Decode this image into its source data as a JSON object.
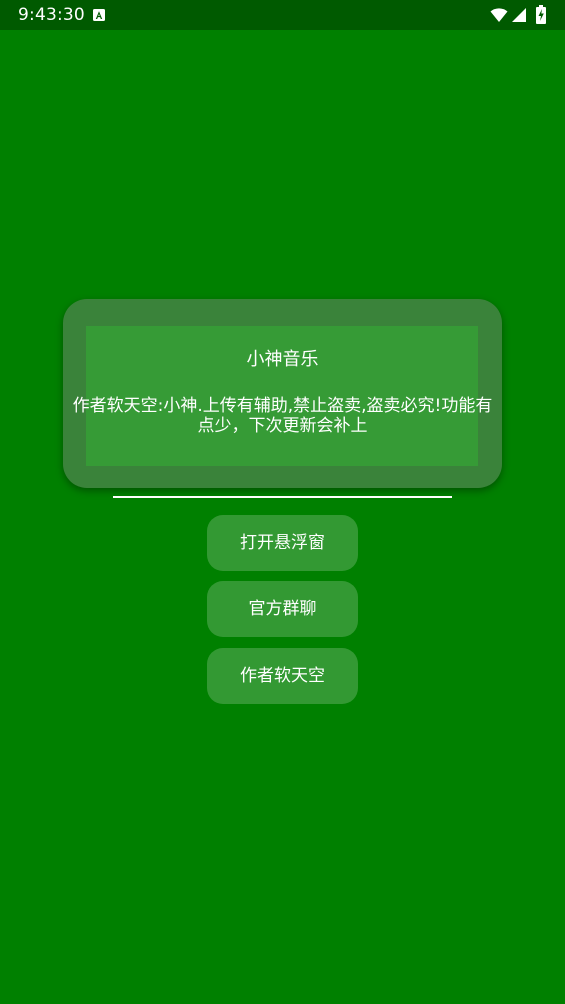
{
  "status_bar": {
    "time": "9:43:30",
    "notification_icon": "font-a-notification-icon",
    "wifi_icon": "wifi-icon",
    "signal_icon": "cell-signal-icon",
    "battery_icon": "battery-charging-icon"
  },
  "dialog": {
    "title": "小神音乐",
    "message": "作者软天空:小神.上传有辅助,禁止盗卖,盗卖必究!功能有点少，下次更新会补上"
  },
  "buttons": {
    "open_float_window": "打开悬浮窗",
    "official_group": "官方群聊",
    "author": "作者软天空"
  },
  "colors": {
    "background": "#008000",
    "status_bar": "#005a00",
    "panel": "#3a833a",
    "panel_inner": "#369b36",
    "button": "#339933",
    "text": "#ffffff"
  }
}
